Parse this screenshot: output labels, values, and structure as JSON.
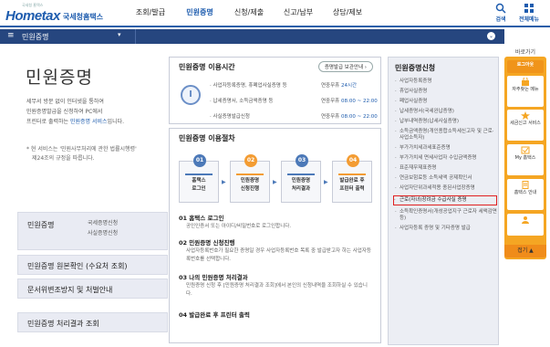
{
  "header": {
    "logo_small": "국세청 홈택스",
    "logo_en": "Hometax",
    "logo_kr": "국세청홈택스",
    "nav": [
      "조회/발급",
      "민원증명",
      "신청/제출",
      "신고/납부",
      "상담/제보"
    ],
    "active_nav": "민원증명",
    "search_label": "검색",
    "menu_label": "전체메뉴"
  },
  "subbar": {
    "title": "민원증명"
  },
  "left": {
    "title": "민원증명",
    "desc_1": "세무서 방문 없이 인터넷을 통하여",
    "desc_2": "민원증명발급을 신청하여 PC에서",
    "desc_3a": "프린터로 출력하는 ",
    "desc_3b": "민원증명 서비스",
    "desc_3c": "입니다.",
    "note_1": "* 현 서비스는 '민원사무처리에 관한 법률시행령'",
    "note_2": "제24조의 규정을 따릅니다.",
    "menus": [
      {
        "label": "민원증명",
        "subs": [
          "국세증명신청",
          "사실증명신청"
        ]
      },
      {
        "label": "민원증명 원본확인 (수요처 조회)"
      },
      {
        "label": "문서위변조방지 및 처벌안내"
      },
      {
        "label": "민원증명 처리결과 조회"
      }
    ]
  },
  "hours": {
    "title": "민원증명 이용시간",
    "button": "증명발급 보관안내 ›",
    "rows": [
      {
        "label": "· 사업자등록증명, 휴폐업사실증명 등",
        "prefix": "연중무휴 ",
        "value": "24시간"
      },
      {
        "label": "· 납세증명서, 소득금액증명 등",
        "prefix": "연중무휴 ",
        "value": "08:00 ~ 22:00"
      },
      {
        "label": "· 사실증명발급신청",
        "prefix": "연중무휴 ",
        "value": "08:00 ~ 22:00"
      }
    ]
  },
  "procedure": {
    "title": "민원증명 이용절차",
    "steps": [
      {
        "num": "01",
        "line1": "홈택스",
        "line2": "로그인"
      },
      {
        "num": "02",
        "line1": "민원증명",
        "line2": "신청진행"
      },
      {
        "num": "03",
        "line1": "민원증명",
        "line2": "처리결과"
      },
      {
        "num": "04",
        "line1": "발급완료 후",
        "line2": "프린터 출력"
      }
    ],
    "details": [
      {
        "title": "01 홈택스 로그인",
        "desc": "공인인증서 또는 아이디/비밀번호로 로그인합니다."
      },
      {
        "title": "02 민원증명 신청진행",
        "desc": "사업자등록번호가 필요한 증명일 경우 사업자등록번호 목록 중 발급받고자 하는 사업자등록번호를 선택합니다."
      },
      {
        "title": "03 나의 민원증명 처리결과",
        "desc": "민원증명 신청 후 [민원증명 처리결과 조회]에서 본인의 신청내역을 조회하실 수 있습니다."
      },
      {
        "title": "04 발급완료 후 프린터 출력",
        "desc": ""
      }
    ]
  },
  "apply": {
    "title": "민원증명신청",
    "items": [
      "사업자등록증명",
      "휴업사실증명",
      "폐업사실증명",
      "납세증명서(국세완납증명)",
      "납부내역증명(납세사실증명)",
      "소득금액증명(개인종합소득세신고자 및 근로·사업소득자)",
      "부가가치세과세표준증명",
      "부가가치세 면세사업자 수입금액증명",
      "표준재무제표증명",
      "연금보험료등 소득세액 공제확인서",
      "사업자단위과세적용 종된사업장증명",
      "근로(자녀)장려금 수급사실 증명",
      "소득확인증명서(개성공업지구 근로자 세액감면 등)",
      "사업자등록 증명 및 기타증명 발급"
    ],
    "highlight_index": 11
  },
  "quick": {
    "title": "바로가기",
    "items": [
      "로그아웃",
      "자주찾는 메뉴",
      "세금신고 서비스",
      "My 홈택스",
      "홈택스 안내"
    ],
    "more": "접기 ▲"
  },
  "colors": {
    "brand": "#1e5cae",
    "bar": "#26467f",
    "quick": "#f5a623",
    "highlight": "#e02020"
  }
}
